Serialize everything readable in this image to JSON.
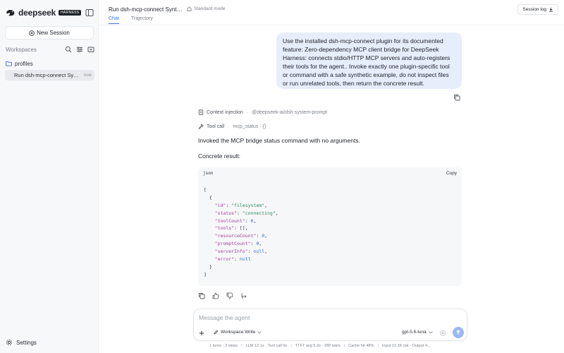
{
  "sidebar": {
    "brand_name": "deepseek",
    "brand_badge": "HARNESS",
    "new_session_label": "New Session",
    "workspaces_label": "Workspaces",
    "folder_label": "profiles",
    "session": {
      "title": "Run dsh-mcp-connect Synthetic",
      "time": "now"
    },
    "settings_label": "Settings"
  },
  "header": {
    "title": "Run dsh-mcp-connect Synthetic",
    "mode": "Standard mode",
    "tabs": [
      {
        "label": "Chat",
        "active": true
      },
      {
        "label": "Trajectory",
        "active": false
      }
    ],
    "session_log_label": "Session log"
  },
  "chat": {
    "user_message": "Use the installed dsh-mcp-connect plugin for its documented feature: Zero-dependency MCP client bridge for DeepSeek Harness: connects stdio/HTTP MCP servers and auto-registers their tools for the agent.. Invoke exactly one plugin-specific tool or command with a safe synthetic example, do not inspect files or run unrelated tools, then return the concrete result.",
    "context_label": "Context injection",
    "context_meta": "@deepseek-ai/dsh-system-prompt",
    "tool_label": "Tool call",
    "tool_meta": "mcp_status · {}",
    "reply_text": "Invoked the MCP bridge status command with no arguments.",
    "result_label": "Concrete result:",
    "code": {
      "lang": "json",
      "copy_label": "Copy",
      "open_bracket": "[",
      "open_brace": "{",
      "close_brace": "}",
      "close_bracket": "]",
      "fields": [
        {
          "key": "\"id\"",
          "value": "\"filesystem\"",
          "type": "s",
          "comma": ","
        },
        {
          "key": "\"status\"",
          "value": "\"connecting\"",
          "type": "s",
          "comma": ","
        },
        {
          "key": "\"toolCount\"",
          "value": "0",
          "type": "n",
          "comma": ","
        },
        {
          "key": "\"tools\"",
          "value": "[]",
          "type": "p",
          "comma": ","
        },
        {
          "key": "\"resourceCount\"",
          "value": "0",
          "type": "n",
          "comma": ","
        },
        {
          "key": "\"promptCount\"",
          "value": "0",
          "type": "n",
          "comma": ","
        },
        {
          "key": "\"serverInfo\"",
          "value": "null",
          "type": "n",
          "comma": ","
        },
        {
          "key": "\"error\"",
          "value": "null",
          "type": "n",
          "comma": ""
        }
      ]
    }
  },
  "composer": {
    "placeholder": "Message the agent",
    "workspace_mode": "Workspace Write",
    "model": "gpt-5.6-luna"
  },
  "status": {
    "turns": "1 turns · 2 steps",
    "llm": "LLM 12.1s · Tool call 0s",
    "ttft": "TTFT avg 5.2s · 280 tok/s",
    "cache": "Cache hit 48%",
    "io": "Input 12.1K tok · Output 4..."
  },
  "colors": {
    "accent": "#3a73e0",
    "user_bubble": "#e6edfb",
    "send_button": "#9bb8ee"
  }
}
